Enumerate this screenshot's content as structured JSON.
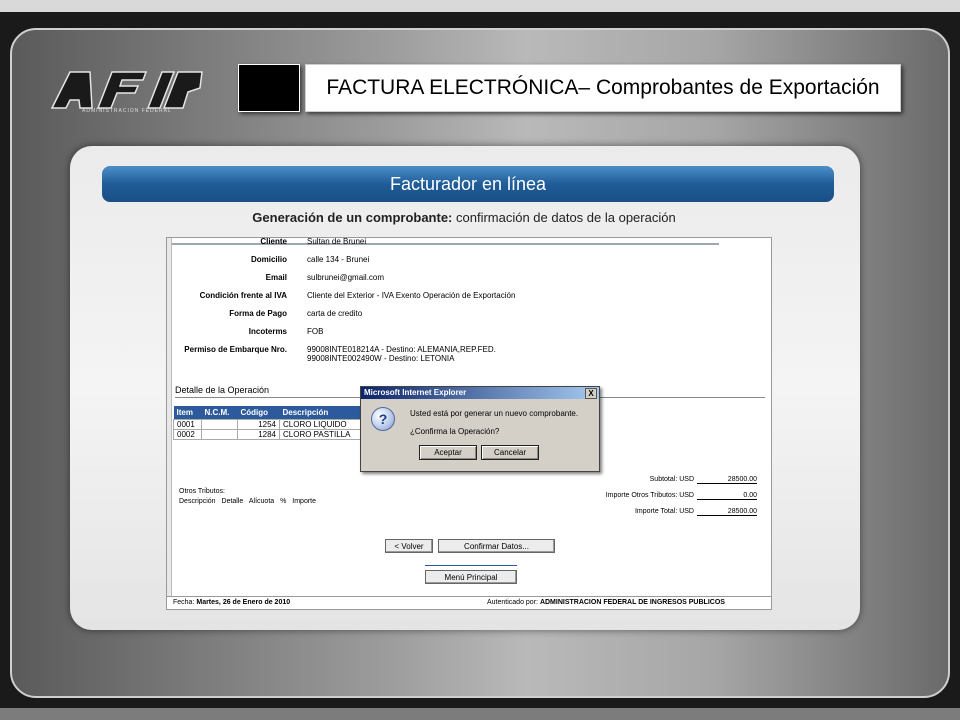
{
  "header": {
    "logo_text": "AFIP",
    "logo_subtext": "ADMINISTRACION FEDERAL",
    "title": "FACTURA ELECTRÓNICA– Comprobantes de Exportación"
  },
  "panel": {
    "bar_title": "Facturador en línea",
    "subtitle_bold": "Generación de un comprobante:",
    "subtitle_rest": " confirmación de datos de la operación"
  },
  "form": {
    "fields": [
      {
        "label": "Cliente",
        "value": "Sultan de Brunei"
      },
      {
        "label": "Domicilio",
        "value": "calle 134 - Brunei"
      },
      {
        "label": "Email",
        "value": "sulbrunei@gmail.com"
      },
      {
        "label": "Condición frente al IVA",
        "value": "Cliente del Exterior - IVA Exento Operación de Exportación"
      },
      {
        "label": "Forma de Pago",
        "value": "carta de credito"
      },
      {
        "label": "Incoterms",
        "value": "FOB"
      },
      {
        "label": "Permiso de Embarque Nro.",
        "value": "99008INTE018214A - Destino: ALEMANIA,REP.FED."
      },
      {
        "label": "",
        "value": "99008INTE002490W - Destino: LETONIA"
      }
    ],
    "detalle_label": "Detalle de la Operación",
    "table_headers": [
      "Item",
      "N.C.M.",
      "Código",
      "Descripción"
    ],
    "rows": [
      [
        "0001",
        "",
        "1254",
        "CLORO LIQUIDO"
      ],
      [
        "0002",
        "",
        "1284",
        "CLORO PASTILLA"
      ]
    ],
    "subtotal_label": "Subtotal: USD",
    "subtotal_value": "28500.00",
    "otros_label": "Importe Otros Tributos: USD",
    "otros_value": "0.00",
    "total_label": "Importe Total: USD",
    "total_value": "28500.00",
    "otros_tributos_title": "Otros Tributos:",
    "otros_tributos_cols": "Descripción Detalle Alícuota % Importe",
    "btn_volver": "< Volver",
    "btn_confirmar": "Confirmar Datos...",
    "btn_menu": "Menú Principal",
    "footer_fecha_label": "Fecha: ",
    "footer_fecha": "Martes, 26 de Enero de 2010",
    "footer_auth_label": "Autenticado por: ",
    "footer_auth": "ADMINISTRACION FEDERAL DE INGRESOS PUBLICOS"
  },
  "dialog": {
    "title": "Microsoft Internet Explorer",
    "close": "X",
    "icon": "question-icon",
    "message1": "Usted está por generar un nuevo comprobante.",
    "message2": "¿Confirma la Operación?",
    "accept": "Aceptar",
    "cancel": "Cancelar"
  }
}
